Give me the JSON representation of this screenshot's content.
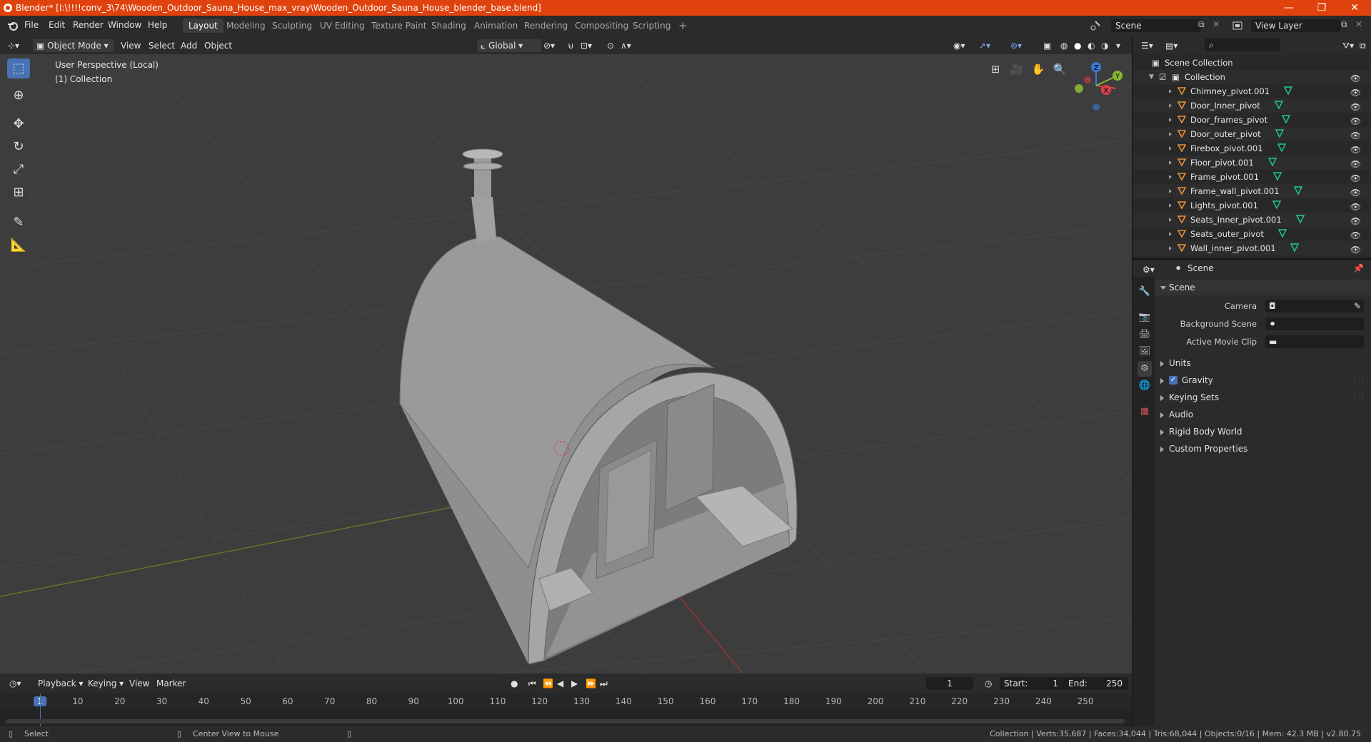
{
  "window": {
    "title": "Blender* [I:\\!!!!conv_3\\74\\Wooden_Outdoor_Sauna_House_max_vray\\Wooden_Outdoor_Sauna_House_blender_base.blend]",
    "minimize": "—",
    "maximize": "❐",
    "close": "✕"
  },
  "menu": [
    "File",
    "Edit",
    "Render",
    "Window",
    "Help"
  ],
  "workspaces": [
    "Layout",
    "Modeling",
    "Sculpting",
    "UV Editing",
    "Texture Paint",
    "Shading",
    "Animation",
    "Rendering",
    "Compositing",
    "Scripting"
  ],
  "active_workspace": "Layout",
  "add_workspace": "+",
  "scene_field": "Scene",
  "view_layer_field": "View Layer",
  "viewport": {
    "mode": "Object Mode",
    "menus": [
      "View",
      "Select",
      "Add",
      "Object"
    ],
    "orientation": "Global",
    "overlay_text": "User Perspective (Local)",
    "collection_text": "(1) Collection",
    "gizmo_axes": {
      "x": "X",
      "y": "Y",
      "z": "Z"
    }
  },
  "timeline": {
    "menus": [
      "Playback",
      "Keying",
      "View",
      "Marker"
    ],
    "current_frame": "1",
    "start_label": "Start:",
    "start": "1",
    "end_label": "End:",
    "end": "250",
    "ticks": [
      "1",
      "10",
      "20",
      "30",
      "40",
      "50",
      "60",
      "70",
      "80",
      "90",
      "100",
      "110",
      "120",
      "130",
      "140",
      "150",
      "160",
      "170",
      "180",
      "190",
      "200",
      "210",
      "220",
      "230",
      "240",
      "250"
    ]
  },
  "statusbar": {
    "left_action": "Select",
    "middle_action": "Center View to Mouse",
    "stats": "Collection | Verts:35,687 | Faces:34,044 | Tris:68,044 | Objects:0/16 | Mem: 42.3 MB | v2.80.75"
  },
  "outliner": {
    "root": "Scene Collection",
    "collection": "Collection",
    "items": [
      "Chimney_pivot.001",
      "Door_Inner_pivot",
      "Door_frames_pivot",
      "Door_outer_pivot",
      "Firebox_pivot.001",
      "Floor_pivot.001",
      "Frame_pivot.001",
      "Frame_wall_pivot.001",
      "Lights_pivot.001",
      "Seats_Inner_pivot.001",
      "Seats_outer_pivot",
      "Wall_inner_pivot.001"
    ]
  },
  "properties": {
    "header": "Scene",
    "panel_title": "Scene",
    "fields": [
      {
        "label": "Camera"
      },
      {
        "label": "Background Scene"
      },
      {
        "label": "Active Movie Clip"
      }
    ],
    "sections": [
      "Units",
      "Gravity",
      "Keying Sets",
      "Audio",
      "Rigid Body World",
      "Custom Properties"
    ],
    "gravity_checked": true
  },
  "colors": {
    "titlebar": "#e0420d",
    "accent": "#4772b3",
    "object_icon": "#e8913a",
    "mesh_icon": "#20c997",
    "x_axis": "#d9404a",
    "y_axis": "#8ab830",
    "z_axis": "#3b79d6"
  }
}
